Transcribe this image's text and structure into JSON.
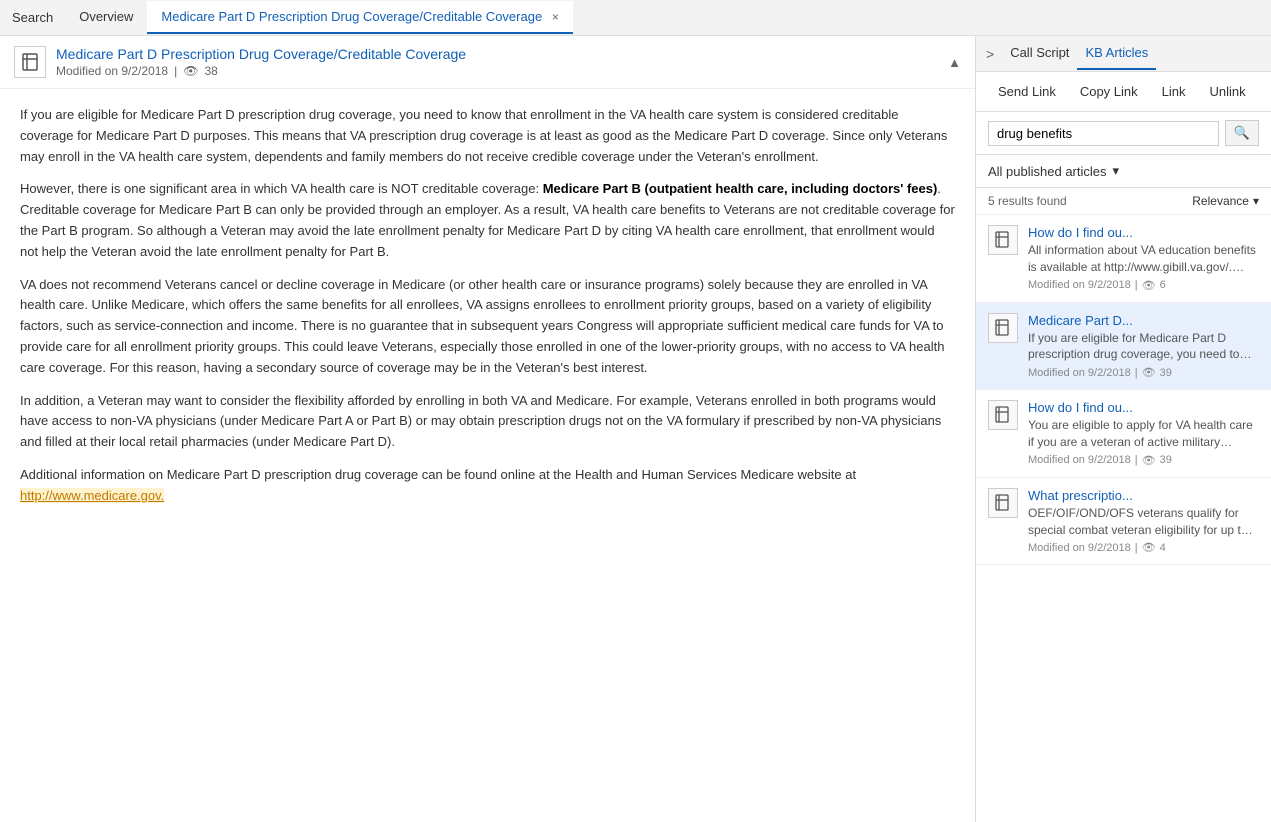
{
  "topNav": {
    "search_label": "Search",
    "overview_label": "Overview",
    "active_tab_label": "Medicare Part D Prescription Drug Coverage/Creditable Coverage",
    "close_icon": "×"
  },
  "article": {
    "title": "Medicare Part D Prescription Drug Coverage/Creditable Coverage",
    "modified": "Modified on 9/2/2018",
    "views": "38",
    "paragraphs": [
      "If you are eligible for Medicare Part D prescription drug coverage, you need to know that enrollment in the VA health care system is considered creditable coverage for Medicare Part D purposes. This means that VA prescription drug coverage is at least as good as the Medicare Part D coverage. Since only Veterans may enroll in the VA health care system, dependents and family members do not receive credible coverage under the Veteran's enrollment.",
      "However, there is one significant area in which VA health care is NOT creditable coverage: Medicare Part B (outpatient health care, including doctors' fees). Creditable coverage for Medicare Part B can only be provided through an employer. As a result, VA health care benefits to Veterans are not creditable coverage for the Part B program. So although a Veteran may avoid the late enrollment penalty for Medicare Part D by citing VA health care enrollment, that enrollment would not help the Veteran avoid the late enrollment penalty for Part B.",
      "VA does not recommend Veterans cancel or decline coverage in Medicare (or other health care or insurance programs) solely because they are enrolled in VA health care. Unlike Medicare, which offers the same benefits for all enrollees, VA assigns enrollees to enrollment priority groups, based on a variety of eligibility factors, such as service-connection and income. There is no guarantee that in subsequent years Congress will appropriate sufficient medical care funds for VA to provide care for all enrollment priority groups. This could leave Veterans, especially those enrolled in one of the lower-priority groups, with no access to VA health care coverage. For this reason, having a secondary source of coverage may be in the Veteran's best interest.",
      "In addition, a Veteran may want to consider the flexibility afforded by enrolling in both VA and Medicare. For example, Veterans enrolled in both programs would have access to non-VA physicians (under Medicare Part A or Part B) or may obtain prescription drugs not on the VA formulary if prescribed by non-VA physicians and filled at their local retail pharmacies (under Medicare Part D).",
      "Additional information on Medicare Part D prescription drug coverage can be found online at the Health and Human Services Medicare website at"
    ],
    "link_text": "http://www.medicare.gov.",
    "bold_phrase": "Medicare Part B (outpatient health care, including doctors' fees)"
  },
  "rightPanel": {
    "chevron_label": ">",
    "call_script_label": "Call Script",
    "kb_articles_label": "KB Articles",
    "actions": {
      "send_link": "Send Link",
      "copy_link": "Copy Link",
      "link": "Link",
      "unlink": "Unlink"
    },
    "search": {
      "value": "drug benefits",
      "placeholder": "drug benefits",
      "button_label": "🔍"
    },
    "filter": {
      "label": "All published articles",
      "dropdown_arrow": "▾"
    },
    "results": {
      "count": "5 results found",
      "sort_label": "Relevance",
      "sort_arrow": "▾"
    },
    "kb_items": [
      {
        "title": "How do I find ou...",
        "snippet": "All information about VA education benefits is available at http://www.gibill.va.gov/.  Benefits and",
        "modified": "Modified on 9/2/2018",
        "views": "6",
        "selected": false
      },
      {
        "title": "Medicare Part D...",
        "snippet": "If you are eligible for Medicare Part D prescription drug coverage, you need to know that enrollment in",
        "modified": "Modified on 9/2/2018",
        "views": "39",
        "selected": true
      },
      {
        "title": "How do I find ou...",
        "snippet": "You are eligible to apply for VA health care if you are a veteran of active military service and were",
        "modified": "Modified on 9/2/2018",
        "views": "39",
        "selected": false
      },
      {
        "title": "What prescriptio...",
        "snippet": "OEF/OIF/OND/OFS veterans qualify for special combat veteran eligibility for up to five years after",
        "modified": "Modified on 9/2/2018",
        "views": "4",
        "selected": false
      }
    ]
  }
}
